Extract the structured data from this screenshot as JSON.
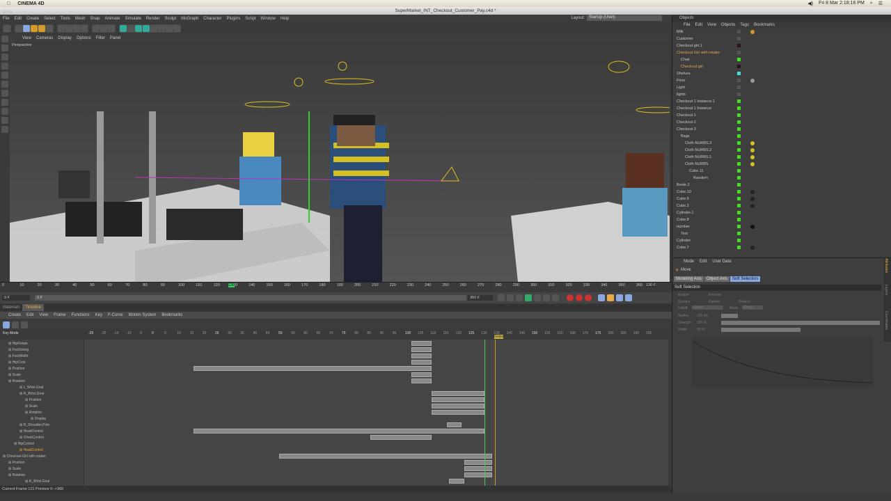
{
  "mac": {
    "app": "CINEMA 4D",
    "datetime": "Fri 8 Mar  2:18:16 PM"
  },
  "window": {
    "title": "SuperMarket_INT_Checkout_Customer_Pay.c4d *"
  },
  "menu": [
    "File",
    "Edit",
    "Create",
    "Select",
    "Tools",
    "Mesh",
    "Snap",
    "Animate",
    "Simulate",
    "Render",
    "Sculpt",
    "MoGraph",
    "Character",
    "Plugins",
    "Script",
    "Window",
    "Help"
  ],
  "layout": {
    "label": "Layout:",
    "value": "Startup (User)"
  },
  "viewport": {
    "menu": [
      "View",
      "Cameras",
      "Display",
      "Options",
      "Filter",
      "Panel"
    ],
    "label": "Perspective"
  },
  "ruler": {
    "ticks": [
      0,
      10,
      20,
      30,
      40,
      50,
      60,
      70,
      80,
      90,
      100,
      110,
      120,
      130,
      140,
      150,
      160,
      170,
      180,
      190,
      200,
      210,
      220,
      230,
      240,
      250,
      260,
      270,
      280,
      290,
      300,
      310,
      320,
      330,
      340,
      350,
      360
    ],
    "current": "130",
    "current_field": "130 F"
  },
  "controls": {
    "start": "0 F",
    "range_start": "0 F",
    "range_end": "360 F",
    "end": "360 F"
  },
  "bottom_tabs": [
    "Materials",
    "Timeline"
  ],
  "timeline": {
    "menu": [
      "Create",
      "Edit",
      "View",
      "Frame",
      "Functions",
      "Key",
      "F-Curve",
      "Motion System",
      "Bookmarks"
    ],
    "key_mode": "Key Mode",
    "header_ticks": [
      -25,
      -20,
      -15,
      -10,
      -5,
      0,
      5,
      10,
      15,
      20,
      25,
      30,
      35,
      40,
      45,
      50,
      55,
      60,
      65,
      70,
      75,
      80,
      85,
      90,
      95,
      100,
      105,
      110,
      115,
      120,
      125,
      130,
      135,
      140,
      145,
      150,
      155,
      160,
      165,
      170,
      175,
      180,
      185,
      190,
      195
    ],
    "current_frame": 130,
    "marker": "Swipe",
    "marker_frame": 134,
    "tracks": [
      {
        "name": "HipRotate",
        "indent": 1,
        "keys": [
          [
            101,
            109
          ]
        ]
      },
      {
        "name": "FootSwing",
        "indent": 1,
        "keys": [
          [
            101,
            109
          ]
        ]
      },
      {
        "name": "FootWidth",
        "indent": 1,
        "keys": [
          [
            101,
            109
          ]
        ]
      },
      {
        "name": "HipCock",
        "indent": 1,
        "keys": [
          [
            101,
            109
          ]
        ]
      },
      {
        "name": "Position",
        "indent": 1,
        "keys": [
          [
            15,
            109
          ]
        ]
      },
      {
        "name": "Scale",
        "indent": 1,
        "keys": [
          [
            101,
            109
          ]
        ]
      },
      {
        "name": "Rotation",
        "indent": 1,
        "keys": [
          [
            101,
            109
          ]
        ]
      },
      {
        "name": "L_Wrist.Goal",
        "indent": 3,
        "keys": []
      },
      {
        "name": "R_Wrist.Goal",
        "indent": 3,
        "keys": [
          [
            109,
            130
          ]
        ]
      },
      {
        "name": "Position",
        "indent": 4,
        "keys": [
          [
            109,
            130
          ]
        ]
      },
      {
        "name": "Scale",
        "indent": 4,
        "keys": [
          [
            109,
            130
          ]
        ]
      },
      {
        "name": "Rotation",
        "indent": 4,
        "keys": [
          [
            109,
            130
          ]
        ]
      },
      {
        "name": "Display",
        "indent": 5,
        "keys": []
      },
      {
        "name": "R_Shoulder.Pole",
        "indent": 3,
        "keys": [
          [
            115,
            121
          ]
        ]
      },
      {
        "name": "HeadControl",
        "indent": 3,
        "keys": [
          [
            15,
            130
          ]
        ]
      },
      {
        "name": "ChestControl",
        "indent": 3,
        "keys": [
          [
            85,
            109
          ]
        ]
      },
      {
        "name": "HipControl",
        "indent": 2,
        "keys": []
      },
      {
        "name": "HeadControl",
        "indent": 3,
        "keys": [],
        "highlight": true
      },
      {
        "name": "Checkout Girl with rotater",
        "indent": 0,
        "keys": [
          [
            49,
            133
          ]
        ]
      },
      {
        "name": "Position",
        "indent": 1,
        "keys": [
          [
            122,
            133
          ]
        ]
      },
      {
        "name": "Scale",
        "indent": 1,
        "keys": [
          [
            122,
            133
          ]
        ]
      },
      {
        "name": "Rotation",
        "indent": 1,
        "keys": [
          [
            122,
            133
          ]
        ]
      },
      {
        "name": "R_Wrist.Goal",
        "indent": 4,
        "keys": [
          [
            116,
            122
          ]
        ]
      }
    ]
  },
  "status": "Current Frame  121  Preview  0-->360",
  "objects": {
    "title": "Objects",
    "menu": [
      "File",
      "Edit",
      "View",
      "Objects",
      "Tags",
      "Bookmarks"
    ],
    "items": [
      {
        "name": "Milk",
        "indent": 0,
        "color": "",
        "tag": "#d49a2a"
      },
      {
        "name": "Customer",
        "indent": 0,
        "color": "",
        "tag": ""
      },
      {
        "name": "Checkout girl.1",
        "indent": 0,
        "color": "#2a1020",
        "tag": ""
      },
      {
        "name": "Checkout Girl with rotater",
        "indent": 0,
        "color": "",
        "tag": "",
        "highlight": true
      },
      {
        "name": "Chair",
        "indent": 1,
        "color": "#44dd22",
        "tag": ""
      },
      {
        "name": "Checkout girl",
        "indent": 1,
        "color": "#2a1020",
        "tag": "",
        "highlight": true
      },
      {
        "name": "Shelves",
        "indent": 0,
        "color": "#44dddd",
        "tag": ""
      },
      {
        "name": "Floor",
        "indent": 0,
        "color": "",
        "tag": "#999"
      },
      {
        "name": "Light",
        "indent": 0,
        "color": "",
        "tag": ""
      },
      {
        "name": "lights",
        "indent": 0,
        "color": "",
        "tag": ""
      },
      {
        "name": "Checkout 1 Instance.1",
        "indent": 0,
        "color": "#44dd22",
        "tag": ""
      },
      {
        "name": "Checkout 1 Instance",
        "indent": 0,
        "color": "#44dd22",
        "tag": ""
      },
      {
        "name": "Checkout 1",
        "indent": 0,
        "color": "#44dd22",
        "tag": ""
      },
      {
        "name": "Checkout 2",
        "indent": 0,
        "color": "#44dd22",
        "tag": ""
      },
      {
        "name": "Checkout 3",
        "indent": 0,
        "color": "#44dd22",
        "tag": ""
      },
      {
        "name": "Bags",
        "indent": 1,
        "color": "#44dd22",
        "tag": ""
      },
      {
        "name": "Cloth NURBS.3",
        "indent": 2,
        "color": "#44dd22",
        "tag": "#d4c020"
      },
      {
        "name": "Cloth NURBS.2",
        "indent": 2,
        "color": "#44dd22",
        "tag": "#d4c020"
      },
      {
        "name": "Cloth NURBS.1",
        "indent": 2,
        "color": "#44dd22",
        "tag": "#d4c020"
      },
      {
        "name": "Cloth NURBS",
        "indent": 2,
        "color": "#44dd22",
        "tag": "#d4c020"
      },
      {
        "name": "Cube.11",
        "indent": 3,
        "color": "#44dd22",
        "tag": ""
      },
      {
        "name": "Random",
        "indent": 4,
        "color": "#44dd22",
        "tag": ""
      },
      {
        "name": "Boole.2",
        "indent": 0,
        "color": "#44dd22",
        "tag": ""
      },
      {
        "name": "Cube.10",
        "indent": 0,
        "color": "#44dd22",
        "tag": "#222"
      },
      {
        "name": "Cube.9",
        "indent": 0,
        "color": "#44dd22",
        "tag": "#222"
      },
      {
        "name": "Cube.2",
        "indent": 0,
        "color": "#44dd22",
        "tag": "#222"
      },
      {
        "name": "Cylinder.1",
        "indent": 0,
        "color": "#44dd22",
        "tag": ""
      },
      {
        "name": "Cube.8",
        "indent": 0,
        "color": "#44dd22",
        "tag": ""
      },
      {
        "name": "number",
        "indent": 0,
        "color": "#44dd22",
        "tag": "#111"
      },
      {
        "name": "Text",
        "indent": 1,
        "color": "#44dd22",
        "tag": ""
      },
      {
        "name": "Cylinder",
        "indent": 0,
        "color": "#44dd22",
        "tag": ""
      },
      {
        "name": "Cube.7",
        "indent": 0,
        "color": "#44dd22",
        "tag": "#222"
      }
    ]
  },
  "attributes": {
    "menu": [
      "Mode",
      "Edit",
      "User Data"
    ],
    "tool": "Move",
    "tabs": [
      "Modeling Axis",
      "Object Axis",
      "Soft Selection"
    ],
    "active_tab": "Soft Selection",
    "section": "Soft Selection",
    "props": {
      "enable": "Enable",
      "preview": "Preview",
      "surface": "Surface",
      "rubber": "Rubber",
      "restrict": "Restrict",
      "falloff": "Falloff",
      "falloff_value": "Linear",
      "mode": "Mode",
      "mode_value": "Group",
      "radius": "Radius",
      "radius_value": "100 cm",
      "strength": "Strength",
      "strength_value": "100 %",
      "width": "Width",
      "width_value": "50 %"
    },
    "side_tabs": [
      "Attributes",
      "Layers",
      "Coordinates"
    ]
  },
  "colors": {
    "accent": "#e7a94a",
    "selection": "#8aa8e0",
    "keyframe_bar": "#888888",
    "playhead": "#44cc55"
  }
}
